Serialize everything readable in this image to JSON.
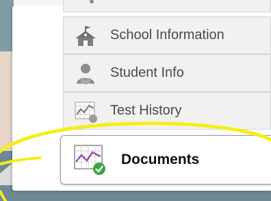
{
  "menu": {
    "items": [
      {
        "label": "",
        "icon": "graduation-icon"
      },
      {
        "label": "School Information",
        "icon": "school-icon"
      },
      {
        "label": "Student Info",
        "icon": "student-icon"
      },
      {
        "label": "Test History",
        "icon": "chart-icon"
      }
    ],
    "active": {
      "label": "Documents",
      "icon": "chart-check-icon"
    }
  },
  "colors": {
    "highlight": "#f5ee1a",
    "icon_grey": "#8c8c8c",
    "check_green": "#3aa640",
    "chart_purple": "#9b4fb0"
  }
}
